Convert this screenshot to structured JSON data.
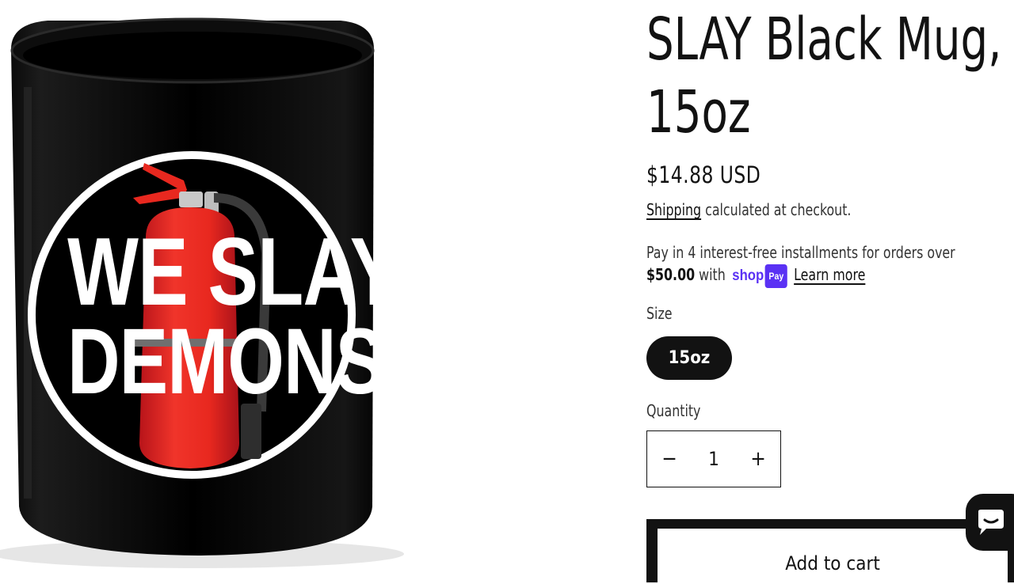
{
  "product": {
    "title_line1": "SLAY Black Mug,",
    "title_line2": "15oz",
    "price": "$14.88 USD",
    "tax_link": "Shipping",
    "tax_rest": "calculated at checkout.",
    "installments_text": "Pay in 4 interest-free installments for orders over",
    "installments_amount": "$50.00",
    "installments_with": "with",
    "shoppay_brand": "shop",
    "shoppay_pay": "Pay",
    "learn_more": "Learn more",
    "size_label": "Size",
    "size_selected": "15oz",
    "quantity_label": "Quantity",
    "quantity_value": "1",
    "minus_symbol": "−",
    "plus_symbol": "+",
    "add_to_cart": "Add to cart"
  },
  "image": {
    "print_line1": "WE SLAY",
    "print_line2": "DEMONS"
  },
  "colors": {
    "accent": "#121212",
    "shop_pay": "#5a31f4",
    "extinguisher": "#e8281f"
  },
  "icons": {
    "chat": "chat-bubble-icon"
  }
}
